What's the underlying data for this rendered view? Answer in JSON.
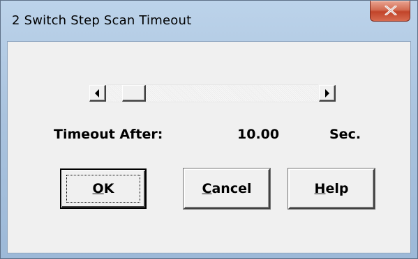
{
  "window": {
    "title": "2 Switch Step Scan Timeout",
    "close_icon": "close-icon"
  },
  "scrollbar": {
    "left_arrow_icon": "arrow-left-icon",
    "right_arrow_icon": "arrow-right-icon",
    "position_fraction": 0.08
  },
  "timeout": {
    "label": "Timeout After:",
    "value": "10.00",
    "unit": "Sec."
  },
  "buttons": {
    "ok": {
      "mnemonic": "O",
      "rest": "K"
    },
    "cancel": {
      "mnemonic": "C",
      "rest": "ancel"
    },
    "help": {
      "mnemonic": "H",
      "rest": "elp"
    }
  },
  "colors": {
    "close_button": "#c1442a",
    "frame": "#aac3de",
    "client": "#f0f0f0"
  }
}
